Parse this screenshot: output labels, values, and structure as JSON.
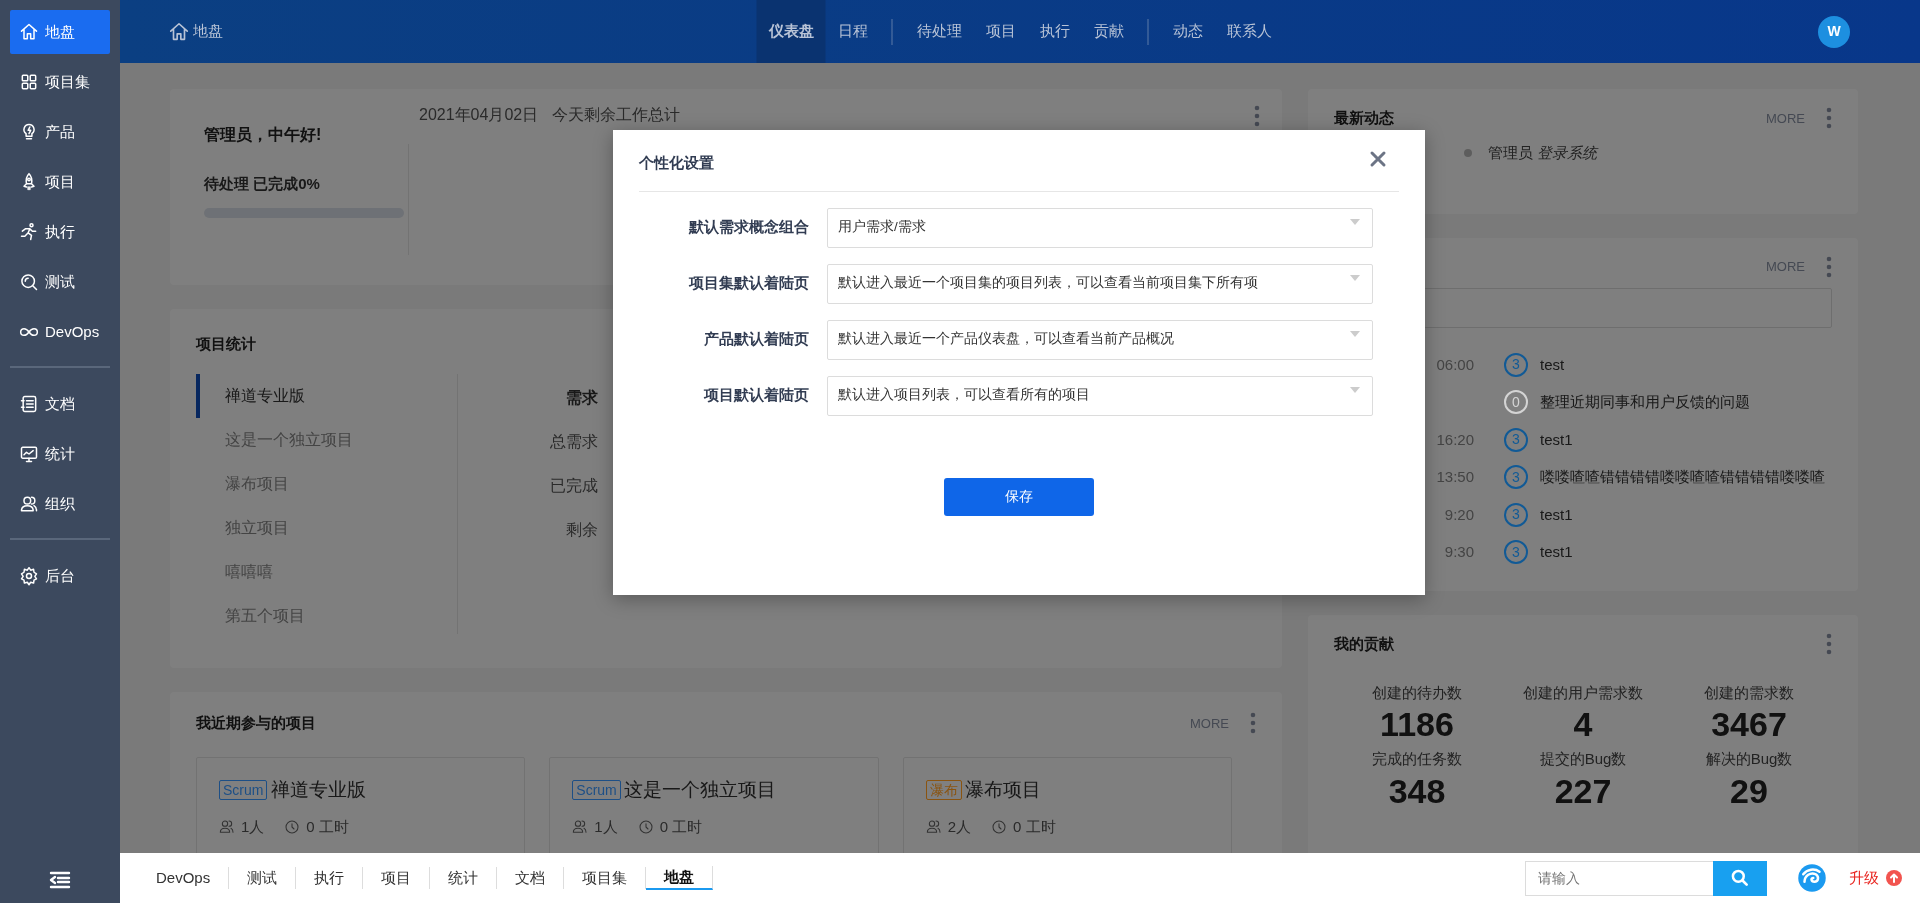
{
  "sidebar": {
    "groups": [
      {
        "items": [
          {
            "label": "地盘",
            "selected": true
          },
          {
            "label": "项目集",
            "selected": false
          },
          {
            "label": "产品",
            "selected": false
          },
          {
            "label": "项目",
            "selected": false
          },
          {
            "label": "执行",
            "selected": false
          },
          {
            "label": "测试",
            "selected": false
          },
          {
            "label": "DevOps",
            "selected": false
          }
        ]
      },
      {
        "items": [
          {
            "label": "文档",
            "selected": false
          },
          {
            "label": "统计",
            "selected": false
          },
          {
            "label": "组织",
            "selected": false
          }
        ]
      },
      {
        "items": [
          {
            "label": "后台",
            "selected": false
          }
        ]
      }
    ]
  },
  "header": {
    "title": "地盘",
    "nav_groups": [
      [
        {
          "label": "仪表盘",
          "selected": true
        },
        {
          "label": "日程",
          "selected": false
        }
      ],
      [
        {
          "label": "待处理",
          "selected": false
        },
        {
          "label": "项目",
          "selected": false
        },
        {
          "label": "执行",
          "selected": false
        },
        {
          "label": "贡献",
          "selected": false
        }
      ],
      [
        {
          "label": "动态",
          "selected": false
        },
        {
          "label": "联系人",
          "selected": false
        }
      ]
    ],
    "avatar": "W"
  },
  "greeting_card": {
    "greeting": "管理员，中午好!",
    "progress_label": "待处理 已完成0%",
    "level": 0,
    "date": "2021年04月02日",
    "summary_title": "今天剩余工作总计"
  },
  "project_stats": {
    "title": "项目统计",
    "projects": [
      {
        "name": "禅道专业版",
        "selected": true
      },
      {
        "name": "这是一个独立项目",
        "selected": false
      },
      {
        "name": "瀑布项目",
        "selected": false
      },
      {
        "name": "独立项目",
        "selected": false
      },
      {
        "name": "嘻嘻嘻",
        "selected": false
      },
      {
        "name": "第五个项目",
        "selected": false
      }
    ],
    "metric_title": "需求",
    "metrics": [
      "总需求",
      "已完成",
      "剩余"
    ]
  },
  "recent_projects": {
    "title": "我近期参与的项目",
    "more": "MORE",
    "projects": [
      {
        "tag": "Scrum",
        "color": "#1d4f86",
        "name": "禅道专业版",
        "members": "1人",
        "hours": "0 工时"
      },
      {
        "tag": "Scrum",
        "color": "#1d4f86",
        "name": "这是一个独立项目",
        "members": "1人",
        "hours": "0 工时"
      },
      {
        "tag": "瀑布",
        "color": "#8a5410",
        "name": "瀑布项目",
        "members": "2人",
        "hours": "0 工时"
      }
    ]
  },
  "activity": {
    "title": "最新动态",
    "more": "MORE",
    "entries": [
      {
        "text": "管理员 *登录系统*"
      }
    ]
  },
  "todos": {
    "more": "MORE",
    "items": [
      {
        "time": "06:00",
        "priority": "3",
        "color": "#115a96",
        "title": "test"
      },
      {
        "priority": "0",
        "color": "#d4d4d4",
        "title": "整理近期同事和用户反馈的问题"
      },
      {
        "time": "16:20",
        "priority": "3",
        "color": "#115a96",
        "title": "test1"
      },
      {
        "time": "13:50",
        "priority": "3",
        "color": "#115a96",
        "title": "喽喽喳喳错错错错喽喽喳喳错错错错喽喽喳"
      },
      {
        "time": "9:20",
        "priority": "3",
        "color": "#115a96",
        "title": "test1"
      },
      {
        "time": "9:30",
        "priority": "3",
        "color": "#115a96",
        "title": "test1"
      }
    ]
  },
  "contribution": {
    "title": "我的贡献",
    "stats": [
      {
        "label": "创建的待办数",
        "value": "1186"
      },
      {
        "label": "创建的用户需求数",
        "value": "4"
      },
      {
        "label": "创建的需求数",
        "value": "3467"
      },
      {
        "label": "完成的任务数",
        "value": "348"
      },
      {
        "label": "提交的Bug数",
        "value": "227"
      },
      {
        "label": "解决的Bug数",
        "value": "29"
      }
    ]
  },
  "modal": {
    "title": "个性化设置",
    "fields": [
      {
        "label": "默认需求概念组合",
        "value": "用户需求/需求"
      },
      {
        "label": "项目集默认着陆页",
        "value": "默认进入最近一个项目集的项目列表，可以查看当前项目集下所有项"
      },
      {
        "label": "产品默认着陆页",
        "value": "默认进入最近一个产品仪表盘，可以查看当前产品概况"
      },
      {
        "label": "项目默认着陆页",
        "value": "默认进入项目列表，可以查看所有的项目"
      }
    ],
    "save": "保存"
  },
  "bottom_bar": {
    "tabs": [
      {
        "label": "DevOps",
        "selected": false
      },
      {
        "label": "测试",
        "selected": false
      },
      {
        "label": "执行",
        "selected": false
      },
      {
        "label": "项目",
        "selected": false
      },
      {
        "label": "统计",
        "selected": false
      },
      {
        "label": "文档",
        "selected": false
      },
      {
        "label": "项目集",
        "selected": false
      },
      {
        "label": "地盘",
        "selected": true
      }
    ],
    "search": {
      "placeholder": "请输入"
    },
    "upgrade": "升级"
  }
}
